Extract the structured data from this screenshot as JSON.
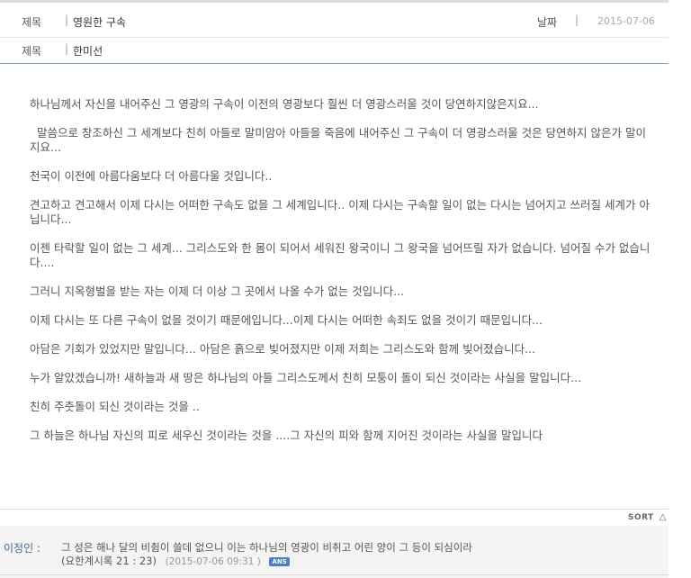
{
  "header": {
    "title_label": "제목",
    "title_value": "영원한 구속",
    "date_label": "날짜",
    "date_value": "2015-07-06",
    "author_label": "제목",
    "author_value": "한미선",
    "separator": "|"
  },
  "content": {
    "paragraphs": [
      "하나님께서 자신을 내어주신 그 영광의 구속이 이전의 영광보다  훨씬 더 영광스러울 것이 당연하지않은지요...",
      "  말씀으로 창조하신 그 세계보다 친히 아들로 말미암아 아들을 죽음에 내어주신 그 구속이 더 영광스러울 것은 당연하지 않은가 말이지요...",
      "천국이 이전에 아름다움보다 더 아름다울 것입니다..",
      "견고하고 견고해서 이제 다시는 어떠한 구속도 없을   그 세계입니다.. 이제 다시는 구속할 일이 없는 다시는 넘어지고 쓰러질 세계가 아닙니다...",
      "이젠 타락할 일이 없는 그 세계... 그리스도와 한 몸이 되어서 세워진 왕국이니 그 왕국을 넘어뜨릴 자가 없습니다. 넘어질 수가 없습니다....",
      "그러니 지옥형벌을 받는 자는 이제 더 이상 그 곳에서 나올 수가 없는 것입니다...",
      "이제 다시는 또 다른 구속이 없을 것이기 때문에입니다...이제 다시는 어떠한 속죄도 없을 것이기 때문입니다...",
      "아담은 기회가 있었지만 말입니다... 아담은 흙으로 빚어졌지만  이제 저희는 그리스도와 함께 빚어졌습니다...",
      "누가 알았겠습니까! 새하늘과 새 땅은   하나님의 아들 그리스도께서 친히 모퉁이 돌이 되신 것이라는 사실을 말입니다...",
      "친히 주춧돌이 되신 것이라는 것을 ..",
      "그 하늘은 하나님 자신의 피로 세우신 것이라는 것을 ....그 자신의 피와 함께 지어진 것이라는 사실을 말입니다"
    ]
  },
  "sort": {
    "label": "SORT",
    "icon": "triangle-up-icon"
  },
  "comment": {
    "author": "이정인 :",
    "text": "그 성은 해나 달의 비췸이 쓸데 없으니 이는 하나님의 영광이 비취고 어린 양이 그 등이 되심이라",
    "reference": "(요한계시록 21 : 23)",
    "date": "(2015-07-06 09:31  )",
    "badge": "ANS"
  }
}
